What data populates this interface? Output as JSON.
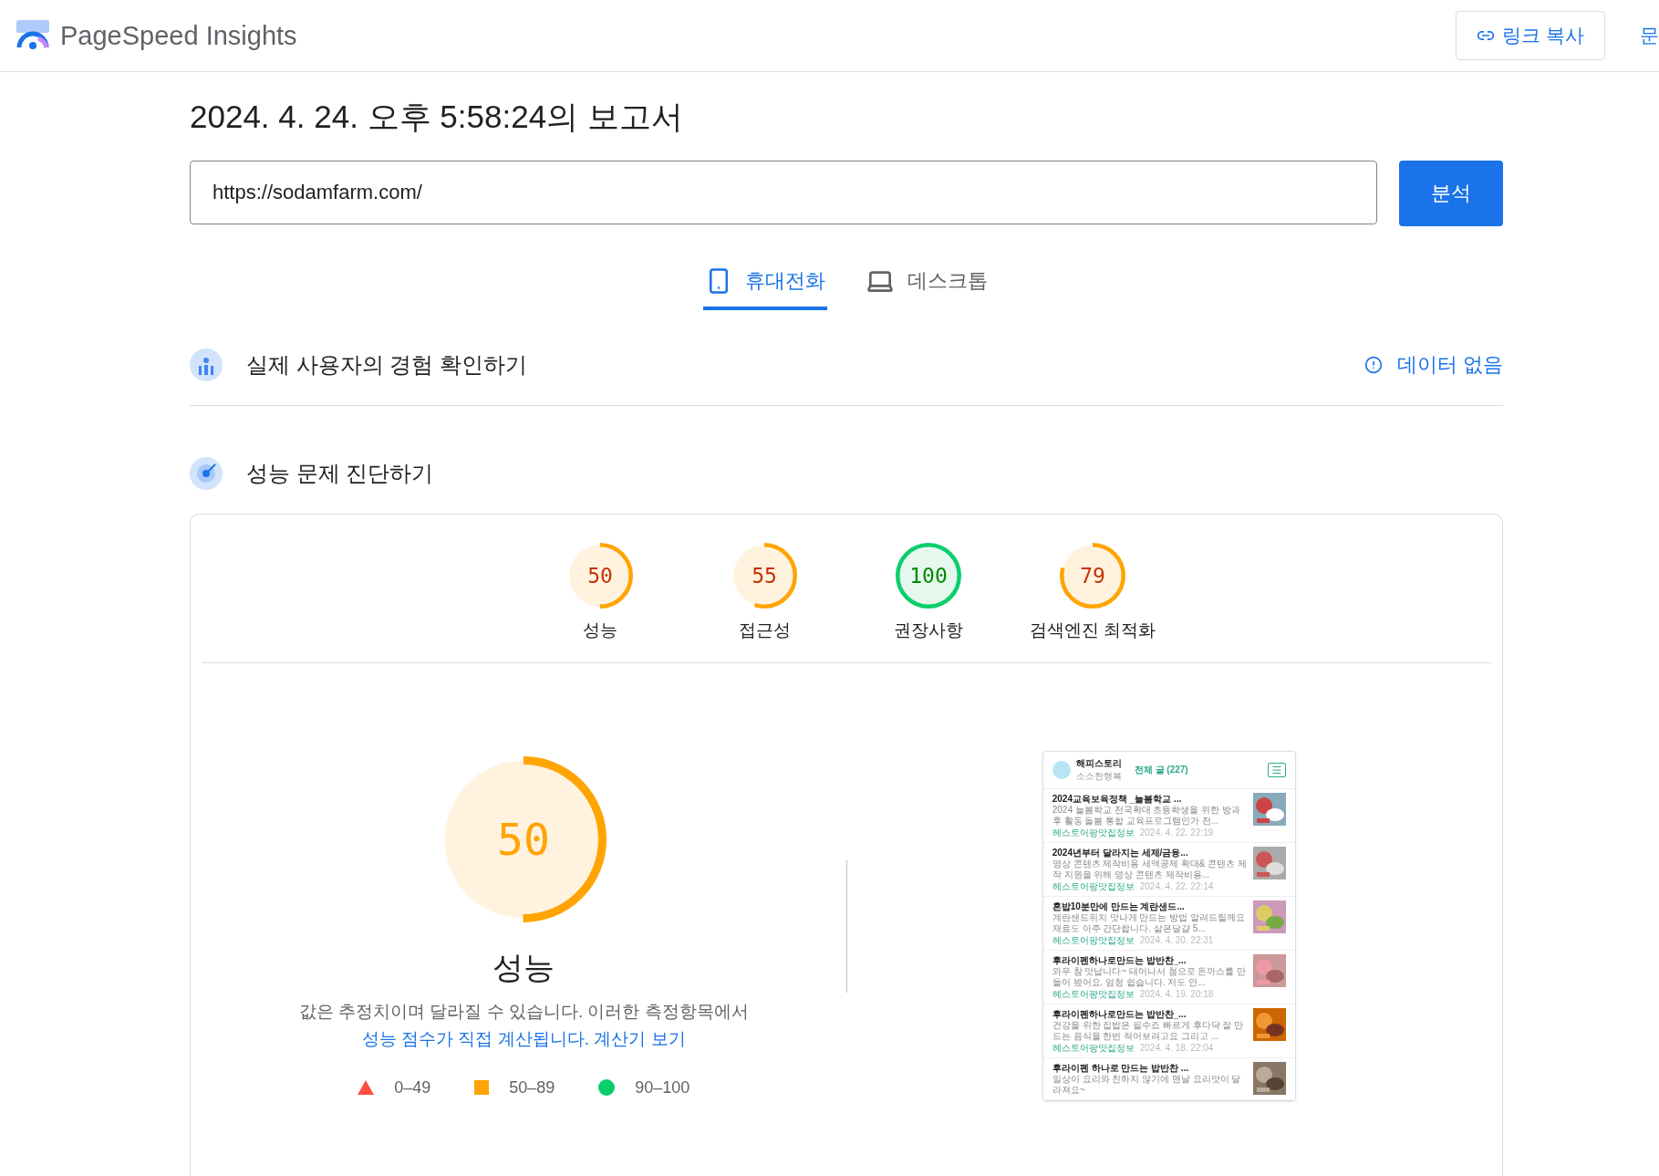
{
  "app": {
    "title": "PageSpeed Insights"
  },
  "header_actions": [
    {
      "label": "링크 복사",
      "kind": "button"
    },
    {
      "label": "문",
      "kind": "link"
    }
  ],
  "report_title": "2024. 4. 24. 오후 5:58:24의 보고서",
  "url_field": {
    "value": "https://sodamfarm.com/"
  },
  "analyze_button": "분석",
  "device_tabs": [
    {
      "label": "휴대전화",
      "selected": true,
      "kind": "mobile"
    },
    {
      "label": "데스크톱",
      "selected": false,
      "kind": "desktop"
    }
  ],
  "sections": [
    {
      "title": "실제 사용자의 경험 확인하기",
      "kind": "field",
      "status": "데이터 없음"
    },
    {
      "title": "성능 문제 진단하기",
      "kind": "lab"
    }
  ],
  "scores": [
    {
      "label": "성능",
      "score": "50"
    },
    {
      "label": "접근성",
      "score": "55"
    },
    {
      "label": "권장사항",
      "score": "100"
    },
    {
      "label": "검색엔진 최적화",
      "score": "79"
    }
  ],
  "main_score": {
    "label": "성능",
    "score": "50",
    "note": "값은 추정치이며 달라질 수 있습니다. 이러한 측정항목에서 ",
    "note_link": "성능 점수가 직접 계산됩니다.",
    "calc_link": "계산기 보기"
  },
  "legend": [
    {
      "range": "0–49",
      "kind": "fail"
    },
    {
      "range": "50–89",
      "kind": "average"
    },
    {
      "range": "90–100",
      "kind": "pass"
    }
  ],
  "preview": {
    "blog_name": "해피스토리",
    "blog_tagline": "소소한행복",
    "all_posts": "전체 글 (227)",
    "posts": [
      {
        "title": "2024교육보육정책 _늘봄학교 ...",
        "snippet": "2024 늘봄학교 전국확대 초등학생을 위한 방과후 활동 돌봄 통합 교육프로그램인가 전...",
        "category": "헤스토어팡맛집정보",
        "date": "2024. 4. 22. 22:19"
      },
      {
        "title": "2024년부터 달라지는 세제/금융...",
        "snippet": "영상 콘텐츠 제작비용 세액공제 확대& 콘텐츠 제작 지원을 위해 영상 콘텐츠 제작비용...",
        "category": "헤스토어팡맛집정보",
        "date": "2024. 4. 22. 22:14"
      },
      {
        "title": "혼밥10분만에 만드는 계란샌드...",
        "snippet": "계란샌드위치 맛나게 만드는 방법 알려드릴께요 재료도 아주 간단합니다. 삶은달걀 5...",
        "category": "헤스토어팡맛집정보",
        "date": "2024. 4. 20. 22:31"
      },
      {
        "title": "후라이펜하나로만드는 밥반찬_...",
        "snippet": "와우 참 맛납니다~ 태어나서 첨으로 돈까스를 만들어 봤어요. 엄청 쉽습니다. 저도 안...",
        "category": "헤스토어팡맛집정보",
        "date": "2024. 4. 19. 20:18"
      },
      {
        "title": "후라이펜하나로만드는 밥반찬_...",
        "snippet": "건강을 위한 집밥은 필수죠 빠르게 후다닥 잘 만드는 음식을 한번 적어보려고요 그리고 ...",
        "category": "헤스토어팡맛집정보",
        "date": "2024. 4. 18. 22:04"
      },
      {
        "title": "후라이펜 하나로 만드는 밥반찬 ...",
        "snippet": "일상이 요리와 친하지 않기에 맨날 요리맛이 달라져요~"
      }
    ]
  }
}
